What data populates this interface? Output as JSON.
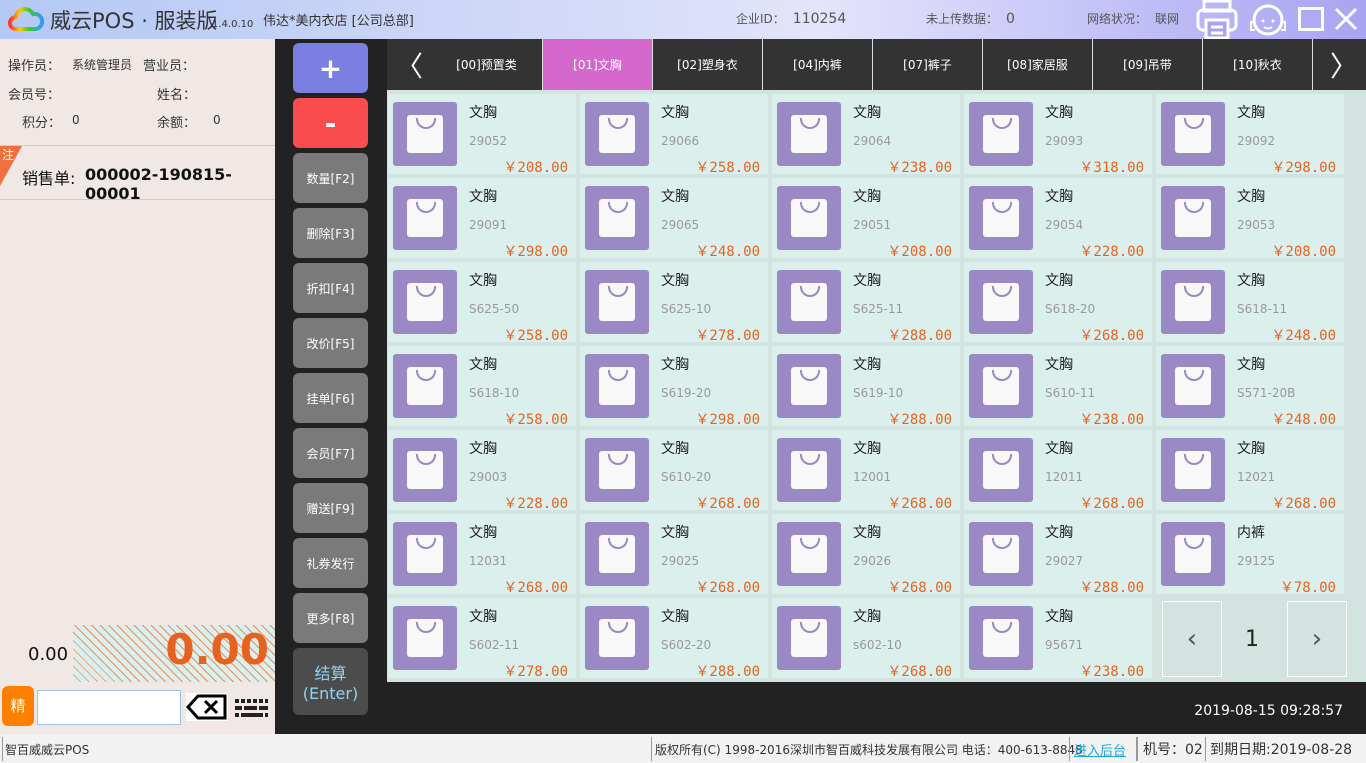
{
  "title": {
    "app": "威云POS · 服装版",
    "version": "1.4.0.10",
    "store": "伟达*美内衣店 [公司总部]",
    "company_id_label": "企业ID：",
    "company_id": "110254",
    "unsent_label": "未上传数据：",
    "unsent": "0",
    "network_label": "网络状况：",
    "network": "联网"
  },
  "info": {
    "operator_label": "操作员：",
    "operator": "系统管理员",
    "sales_label": "营业员：",
    "member_label": "会员号：",
    "name_label": "姓名：",
    "points_label": "积分：",
    "points": "0",
    "balance_label": "余额：",
    "balance": "0"
  },
  "order": {
    "badge": "注",
    "label": "销售单:",
    "number": "000002-190815-00001",
    "subtotal": "0.00",
    "total": "0.00",
    "precise": "精",
    "input_value": ""
  },
  "buttons": {
    "plus": "+",
    "minus": "-",
    "qty": "数量[F2]",
    "del": "删除[F3]",
    "discount": "折扣[F4]",
    "price": "改价[F5]",
    "hold": "挂单[F6]",
    "member": "会员[F7]",
    "gift": "赠送[F9]",
    "coupon": "礼券发行",
    "more": "更多[F8]",
    "checkout1": "结算",
    "checkout2": "(Enter)"
  },
  "tabs": [
    "[00]预置类",
    "[01]文胸",
    "[02]塑身衣",
    "[04]内裤",
    "[07]裤子",
    "[08]家居服",
    "[09]吊带",
    "[10]秋衣"
  ],
  "active_tab": 1,
  "accent": {
    "tab_active": "#d468cc",
    "price": "#e8621f"
  },
  "products": [
    {
      "n": "文胸",
      "c": "29052",
      "p": "￥208.00"
    },
    {
      "n": "文胸",
      "c": "29066",
      "p": "￥258.00"
    },
    {
      "n": "文胸",
      "c": "29064",
      "p": "￥238.00"
    },
    {
      "n": "文胸",
      "c": "29093",
      "p": "￥318.00"
    },
    {
      "n": "文胸",
      "c": "29092",
      "p": "￥298.00"
    },
    {
      "n": "文胸",
      "c": "29091",
      "p": "￥298.00"
    },
    {
      "n": "文胸",
      "c": "29065",
      "p": "￥248.00"
    },
    {
      "n": "文胸",
      "c": "29051",
      "p": "￥208.00"
    },
    {
      "n": "文胸",
      "c": "29054",
      "p": "￥228.00"
    },
    {
      "n": "文胸",
      "c": "29053",
      "p": "￥208.00"
    },
    {
      "n": "文胸",
      "c": "S625-50",
      "p": "￥258.00"
    },
    {
      "n": "文胸",
      "c": "S625-10",
      "p": "￥278.00"
    },
    {
      "n": "文胸",
      "c": "S625-11",
      "p": "￥288.00"
    },
    {
      "n": "文胸",
      "c": "S618-20",
      "p": "￥268.00"
    },
    {
      "n": "文胸",
      "c": "S618-11",
      "p": "￥248.00"
    },
    {
      "n": "文胸",
      "c": "S618-10",
      "p": "￥258.00"
    },
    {
      "n": "文胸",
      "c": "S619-20",
      "p": "￥298.00"
    },
    {
      "n": "文胸",
      "c": "S619-10",
      "p": "￥288.00"
    },
    {
      "n": "文胸",
      "c": "S610-11",
      "p": "￥238.00"
    },
    {
      "n": "文胸",
      "c": "S571-20B",
      "p": "￥248.00"
    },
    {
      "n": "文胸",
      "c": "29003",
      "p": "￥228.00"
    },
    {
      "n": "文胸",
      "c": "S610-20",
      "p": "￥268.00"
    },
    {
      "n": "文胸",
      "c": "12001",
      "p": "￥268.00"
    },
    {
      "n": "文胸",
      "c": "12011",
      "p": "￥268.00"
    },
    {
      "n": "文胸",
      "c": "12021",
      "p": "￥268.00"
    },
    {
      "n": "文胸",
      "c": "12031",
      "p": "￥268.00"
    },
    {
      "n": "文胸",
      "c": "29025",
      "p": "￥268.00"
    },
    {
      "n": "文胸",
      "c": "29026",
      "p": "￥268.00"
    },
    {
      "n": "文胸",
      "c": "29027",
      "p": "￥288.00"
    },
    {
      "n": "内裤",
      "c": "29125",
      "p": "￥78.00"
    },
    {
      "n": "文胸",
      "c": "S602-11",
      "p": "￥278.00"
    },
    {
      "n": "文胸",
      "c": "S602-20",
      "p": "￥288.00"
    },
    {
      "n": "文胸",
      "c": "s602-10",
      "p": "￥268.00"
    },
    {
      "n": "文胸",
      "c": "95671",
      "p": "￥238.00"
    }
  ],
  "pager": {
    "page": "1"
  },
  "clock": "2019-08-15 09:28:57",
  "status": {
    "app": "智百威威云POS",
    "copyright": "版权所有(C) 1998-2016深圳市智百威科技发展有限公司 电话：400-613-8848",
    "backend": "进入后台",
    "machine": "机号：02",
    "expiry": "到期日期:2019-08-28"
  }
}
